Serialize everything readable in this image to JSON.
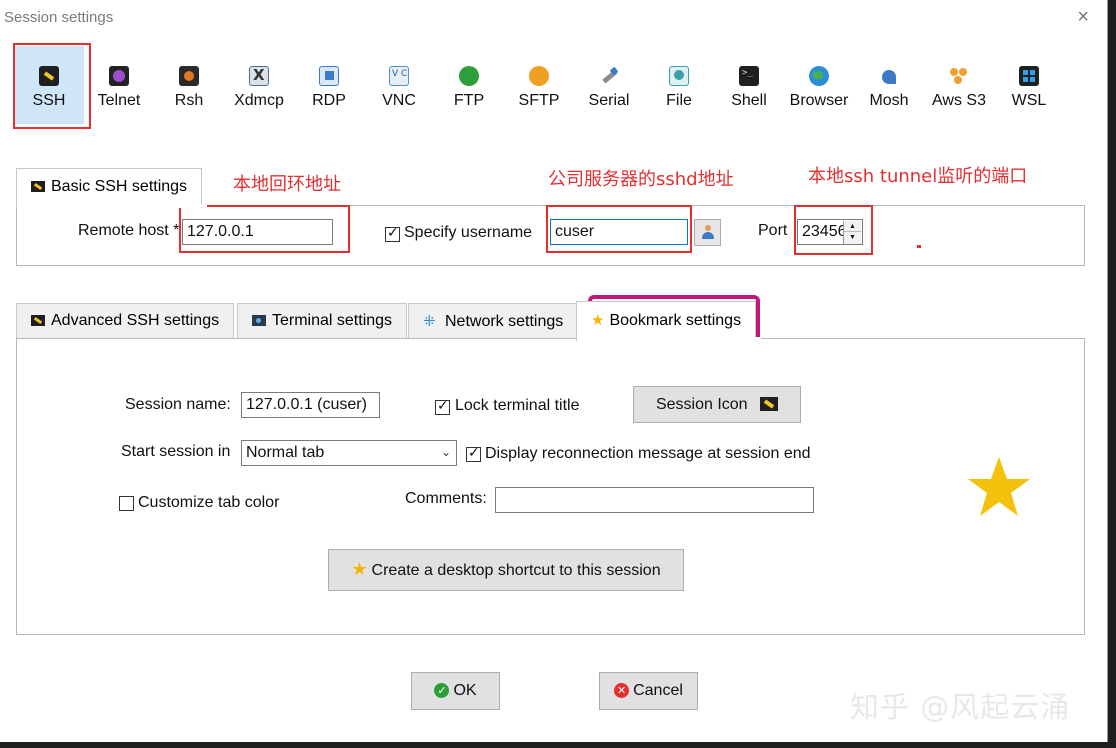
{
  "window": {
    "title": "Session settings",
    "close_glyph": "×"
  },
  "session_types": [
    {
      "label": "SSH",
      "icon": "ssh-key-icon",
      "color": "#1f1f1f"
    },
    {
      "label": "Telnet",
      "icon": "telnet-icon",
      "color": "#7b3fa0"
    },
    {
      "label": "Rsh",
      "icon": "rsh-icon",
      "color": "#2a2a2a"
    },
    {
      "label": "Xdmcp",
      "icon": "xdmcp-icon",
      "color": "#4d6b8a"
    },
    {
      "label": "RDP",
      "icon": "rdp-icon",
      "color": "#3a7bc8"
    },
    {
      "label": "VNC",
      "icon": "vnc-icon",
      "color": "#4f8fd1"
    },
    {
      "label": "FTP",
      "icon": "ftp-icon",
      "color": "#2e9e3a"
    },
    {
      "label": "SFTP",
      "icon": "sftp-icon",
      "color": "#f0a020"
    },
    {
      "label": "Serial",
      "icon": "serial-icon",
      "color": "#8b8b8b"
    },
    {
      "label": "File",
      "icon": "file-icon",
      "color": "#3aa0a8"
    },
    {
      "label": "Shell",
      "icon": "shell-icon",
      "color": "#1f1f1f"
    },
    {
      "label": "Browser",
      "icon": "globe-icon",
      "color": "#2b8fd6"
    },
    {
      "label": "Mosh",
      "icon": "mosh-icon",
      "color": "#3c79c4"
    },
    {
      "label": "Aws S3",
      "icon": "aws-s3-icon",
      "color": "#f0a030"
    },
    {
      "label": "WSL",
      "icon": "windows-icon",
      "color": "#2d6fc8"
    }
  ],
  "basic": {
    "tab_label": "Basic SSH settings",
    "remote_host_label": "Remote host *",
    "remote_host_value": "127.0.0.1",
    "specify_username_label": "Specify username",
    "username_value": "cuser",
    "port_label": "Port",
    "port_value": "23456"
  },
  "annotations": {
    "local_loopback": "本地回环地址",
    "company_sshd": "公司服务器的sshd地址",
    "tunnel_port": "本地ssh tunnel监听的端口"
  },
  "tabs": [
    {
      "label": "Advanced SSH settings"
    },
    {
      "label": "Terminal settings"
    },
    {
      "label": "Network settings"
    },
    {
      "label": "Bookmark settings"
    }
  ],
  "bookmark": {
    "session_name_label": "Session name:",
    "session_name_value": "127.0.0.1 (cuser)",
    "lock_title_label": "Lock terminal title",
    "session_icon_label": "Session Icon",
    "start_session_label": "Start session in",
    "start_session_value": "Normal tab",
    "display_reconnect_label": "Display reconnection message at session end",
    "customize_tab_color_label": "Customize tab color",
    "comments_label": "Comments:",
    "comments_value": "",
    "desktop_shortcut_label": "Create a desktop shortcut to this session",
    "star_color": "#f4c20d"
  },
  "footer": {
    "ok_label": "OK",
    "cancel_label": "Cancel"
  },
  "watermark": "知乎 @风起云涌"
}
